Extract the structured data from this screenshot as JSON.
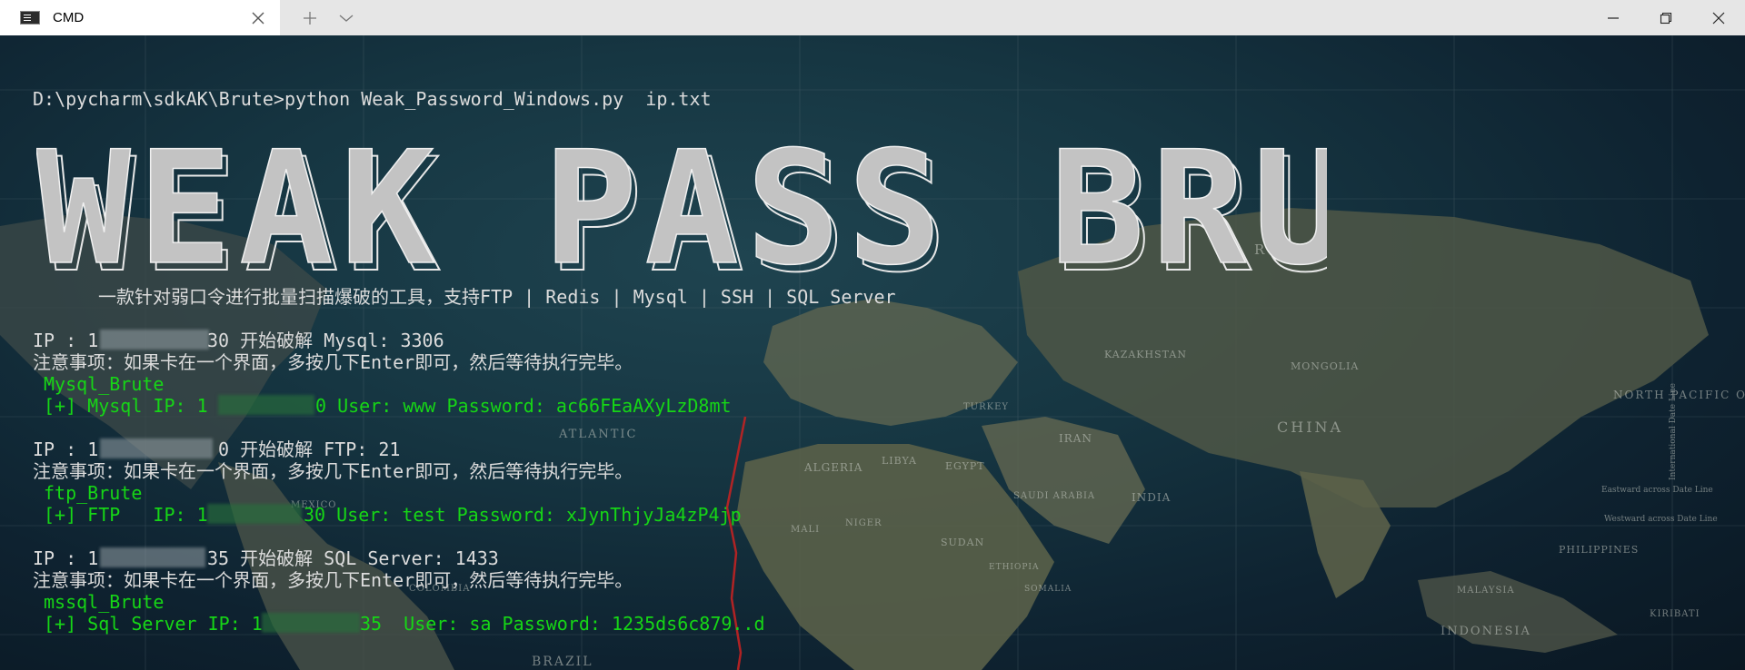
{
  "window": {
    "tab_title": "CMD",
    "tab_icon": "terminal-icon",
    "close_tab_icon": "close-icon",
    "new_tab_icon": "plus-icon",
    "dropdown_icon": "chevron-down-icon",
    "controls": [
      "minimize-icon",
      "maximize-icon",
      "close-icon"
    ]
  },
  "colors": {
    "titlebar": "#e6e6e6",
    "tab_active": "#ffffff",
    "terminal_text": "#dcdcdc",
    "success_text": "#16d616",
    "banner_fill": "#c3c3c3"
  },
  "terminal": {
    "command": "D:\\pycharm\\sdkAK\\Brute>python Weak_Password_Windows.py  ip.txt",
    "banner_text": "WEAK PASS BRUTE",
    "subtitle": "一款针对弱口令进行批量扫描爆破的工具，支持FTP | Redis | Mysql | SSH | SQL Server",
    "blocks": [
      {
        "ip_prefix": "IP : 1",
        "ip_suffix": "30 开始破解 Mysql: 3306",
        "notice": "注意事项：如果卡在一个界面，多按几下Enter即可，然后等待执行完毕。",
        "module": "Mysql_Brute",
        "result_prefix": "[+] Mysql IP: 1",
        "result_suffix": "0 User: www Password: ac66FEaAXyLzD8mt"
      },
      {
        "ip_prefix": "IP : 1",
        "ip_suffix": "0 开始破解 FTP: 21",
        "notice": "注意事项：如果卡在一个界面，多按几下Enter即可，然后等待执行完毕。",
        "module": "ftp_Brute",
        "result_prefix": "[+] FTP   IP: 1",
        "result_suffix": "30 User: test Password: xJynThjyJa4zP4jp"
      },
      {
        "ip_prefix": "IP : 1",
        "ip_suffix": "35 开始破解 SQL Server: 1433",
        "notice": "注意事项：如果卡在一个界面，多按几下Enter即可，然后等待执行完毕。",
        "module": "mssql_Brute",
        "result_prefix": "[+] Sql Server IP: 1",
        "result_suffix": "35  User: sa Password: 1235ds6c879..d"
      }
    ]
  },
  "map_labels": {
    "russia": "RUSSIA",
    "kazakhstan": "KAZAKHSTAN",
    "mongolia": "MONGOLIA",
    "china": "CHINA",
    "north_pacific": "NORTH\nPACIFIC\nOCEAN",
    "iran": "IRAN",
    "india": "INDIA",
    "saudi": "SAUDI\nARABIA",
    "turkey": "TURKEY",
    "libya": "LIBYA",
    "egypt": "EGYPT",
    "algeria": "ALGERIA",
    "sudan": "SUDAN",
    "ethiopia": "ETHIOPIA",
    "somalia": "SOMALIA",
    "mali": "MALI",
    "niger": "NIGER",
    "atlantic": "ATLANTIC",
    "mexico": "MEXICO",
    "colombia": "COLOMBIA",
    "brazil": "BRAZIL",
    "philippines": "PHILIPPINES",
    "indonesia": "INDONESIA",
    "malaysia": "MALAYSIA",
    "kiribati": "KIRIBATI",
    "date_line": "International Date Line",
    "eastward": "Eastward across Date Line",
    "westward": "Westward across Date Line"
  }
}
